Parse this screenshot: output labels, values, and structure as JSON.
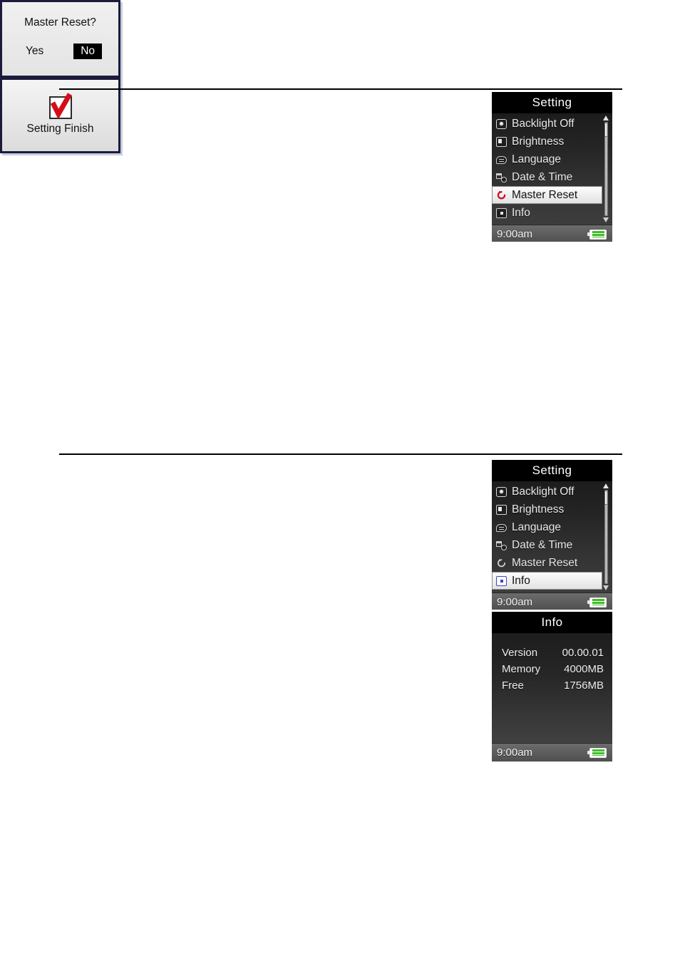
{
  "page": {
    "rules": [
      "top-rule",
      "middle-rule"
    ]
  },
  "setting_screen_1": {
    "title": "Setting",
    "items": [
      {
        "label": "Backlight Off",
        "icon": "backlight-icon",
        "selected": false
      },
      {
        "label": "Brightness",
        "icon": "brightness-icon",
        "selected": false
      },
      {
        "label": "Language",
        "icon": "language-icon",
        "selected": false
      },
      {
        "label": "Date & Time",
        "icon": "datetime-icon",
        "selected": false
      },
      {
        "label": "Master Reset",
        "icon": "reset-icon",
        "selected": true
      },
      {
        "label": "Info",
        "icon": "info-icon",
        "selected": false
      }
    ],
    "statusbar": {
      "clock": "9:00am",
      "battery": "battery-icon"
    },
    "scrollbar": {
      "up": "scroll-up-arrow",
      "down": "scroll-down-arrow"
    }
  },
  "master_reset_dialog": {
    "title": "Master Reset?",
    "choices": [
      {
        "label": "Yes",
        "active": false
      },
      {
        "label": "No",
        "active": true
      }
    ]
  },
  "setting_finish": {
    "icon": "red-check-icon",
    "label": "Setting Finish"
  },
  "setting_screen_2": {
    "title": "Setting",
    "items": [
      {
        "label": "Backlight Off",
        "icon": "backlight-icon",
        "selected": false
      },
      {
        "label": "Brightness",
        "icon": "brightness-icon",
        "selected": false
      },
      {
        "label": "Language",
        "icon": "language-icon",
        "selected": false
      },
      {
        "label": "Date & Time",
        "icon": "datetime-icon",
        "selected": false
      },
      {
        "label": "Master Reset",
        "icon": "reset-icon",
        "selected": false
      },
      {
        "label": "Info",
        "icon": "info-icon",
        "selected": true
      }
    ],
    "statusbar": {
      "clock": "9:00am",
      "battery": "battery-icon"
    },
    "scrollbar": {
      "up": "scroll-up-arrow",
      "down": "scroll-down-arrow"
    }
  },
  "info_screen": {
    "title": "Info",
    "rows": [
      {
        "key": "Version",
        "value": "00.00.01"
      },
      {
        "key": "Memory",
        "value": "4000MB"
      },
      {
        "key": "Free",
        "value": "1756MB"
      }
    ],
    "statusbar": {
      "clock": "9:00am",
      "battery": "battery-icon"
    }
  },
  "colors": {
    "reset_red": "#cc1122",
    "check_red": "#d40d17",
    "battery_green": "#3fbd2a",
    "selection_blue": "#3a46c8",
    "dialog_border": "#1b1b3d"
  }
}
